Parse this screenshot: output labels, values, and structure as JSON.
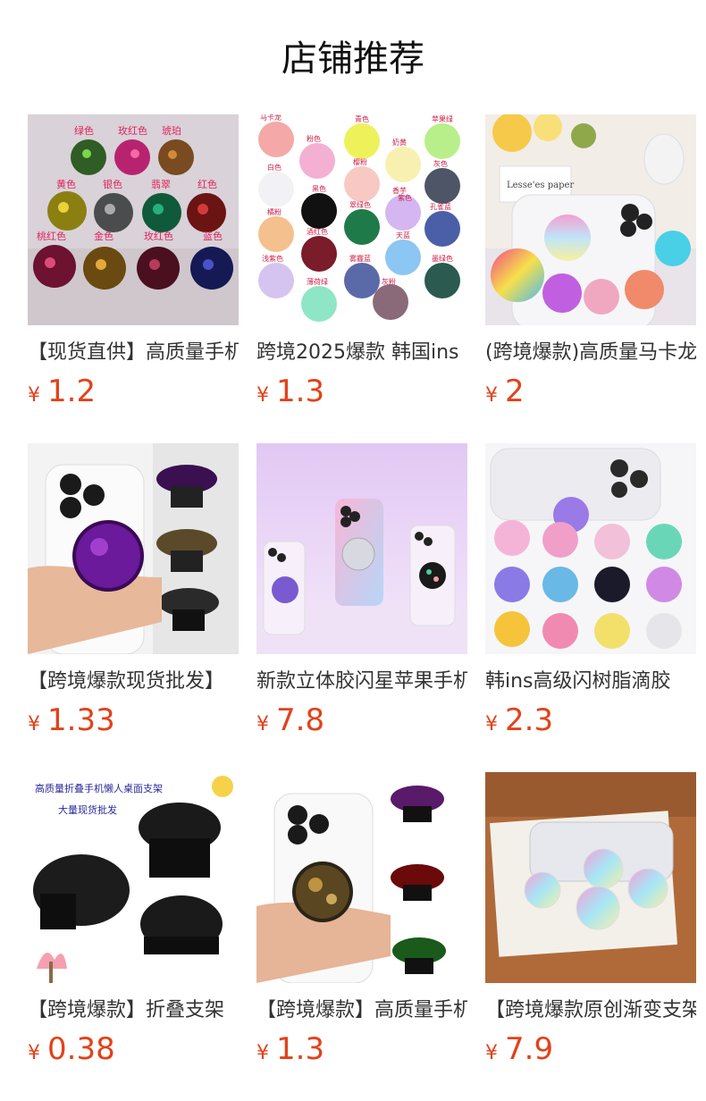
{
  "header": {
    "title": "店铺推荐"
  },
  "currency_symbol": "¥",
  "products": [
    {
      "title": "【现货直供】高质量手机支架",
      "price": "1.2",
      "image": "glitter-grips-photo",
      "image_text": [
        "绿色",
        "玫红色",
        "琥珀",
        "黄色",
        "银色",
        "翡翠",
        "红色",
        "桃红色",
        "金色",
        "玫红色",
        "蓝色"
      ]
    },
    {
      "title": "跨境2025爆款 韩国ins",
      "price": "1.3",
      "image": "pastel-grips-photo",
      "image_text": [
        "马卡龙",
        "青色",
        "苹果绿",
        "粉色",
        "樱粉",
        "奶黄",
        "灰色",
        "白色",
        "黑色",
        "翠绿色",
        "香芋",
        "紫色",
        "孔雀蓝",
        "橘粉",
        "酒红色",
        "天蓝",
        "浅紫色",
        "雾霾蓝",
        "墨绿色",
        "薄荷绿",
        "灰粉"
      ]
    },
    {
      "title": "(跨境爆款)高质量马卡龙",
      "price": "2",
      "image": "gradient-grips-photo",
      "image_text": [
        "Lesse'es paper"
      ]
    },
    {
      "title": "【跨境爆款现货批发】",
      "price": "1.33",
      "image": "phone-purple-grip-photo"
    },
    {
      "title": "新款立体胶闪星苹果手机",
      "price": "7.8",
      "image": "three-phones-photo"
    },
    {
      "title": "韩ins高级闪树脂滴胶",
      "price": "2.3",
      "image": "sequin-grips-grid-photo"
    },
    {
      "title": "【跨境爆款】折叠支架",
      "price": "0.38",
      "image": "black-folding-grips-photo",
      "image_text": [
        "高质量折叠手机懒人桌面支架",
        "大量现货批发"
      ]
    },
    {
      "title": "【跨境爆款】高质量手机",
      "price": "1.3",
      "image": "gold-grip-hand-photo"
    },
    {
      "title": "【跨境爆款原创渐变支架",
      "price": "7.9",
      "image": "iridescent-grips-table-photo"
    }
  ]
}
